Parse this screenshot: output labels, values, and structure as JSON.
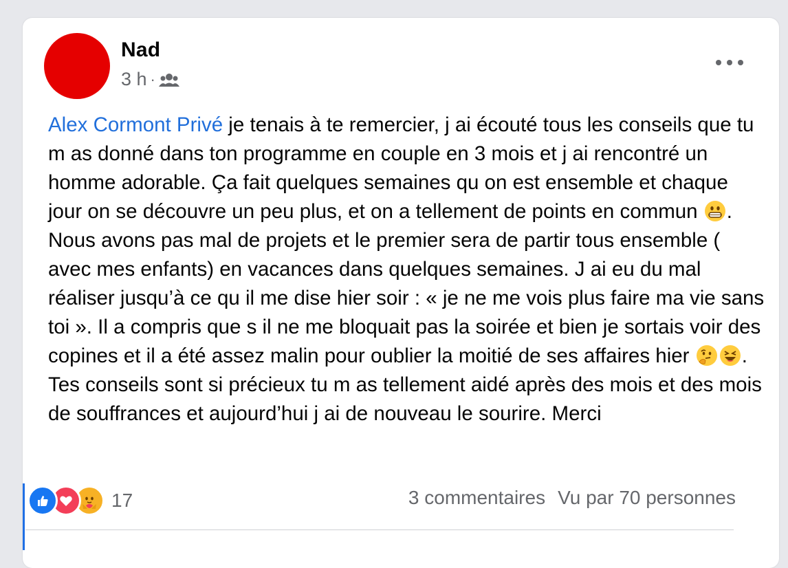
{
  "post": {
    "author": "Nad",
    "time": "3 h",
    "separator": "·",
    "audience_icon": "group-icon",
    "more_icon": "more-horizontal-icon",
    "avatar_color": "#e50000",
    "mention": "Alex Cormont Privé",
    "text_part1": " je tenais à te remercier, j ai écouté tous les conseils que tu m as donné dans ton programme en couple en 3 mois et j ai rencontré un homme adorable. Ça fait quelques semaines qu on est ensemble et chaque jour on se découvre un peu plus, et on a tellement de points en commun ",
    "emoji1": "grinning-face-emoji",
    "text_part2": ". Nous avons pas mal de projets et le premier sera de partir tous ensemble ( avec mes enfants) en vacances dans quelques semaines. J ai eu du mal réaliser jusqu’à ce qu il me dise hier soir : «  je ne me vois plus faire ma vie sans toi ». Il a compris que s il ne me bloquait pas la soirée et bien je sortais voir des copines et il a été assez malin pour oublier la moitié de ses affaires hier ",
    "emoji2": "thinking-face-emoji",
    "emoji3": "laughing-face-emoji",
    "text_part3": ". Tes conseils sont si précieux tu m as tellement aidé après des mois et des mois de souffrances et aujourd’hui j ai de nouveau le sourire. Merci"
  },
  "footer": {
    "reactions": [
      "like",
      "love",
      "care"
    ],
    "reaction_count": "17",
    "comments": "3 commentaires",
    "views": "Vu par 70 personnes"
  },
  "colors": {
    "mention": "#216fdb",
    "like": "#1877f2",
    "love": "#f33e58",
    "care": "#f7b125"
  }
}
